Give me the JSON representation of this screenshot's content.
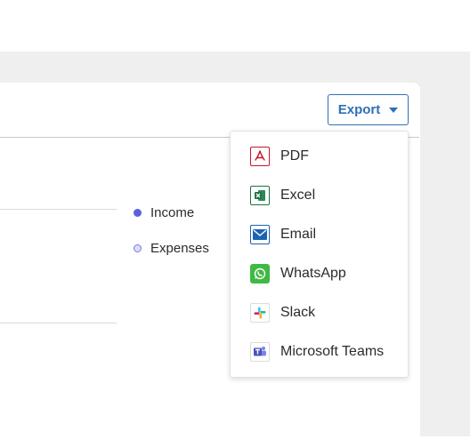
{
  "export": {
    "label": "Export",
    "icon": "chevron-down-icon"
  },
  "legend": [
    {
      "label": "Income",
      "color": "#5b5fe0"
    },
    {
      "label": "Expenses",
      "color": "#d9dbff"
    }
  ],
  "menu": {
    "items": [
      {
        "label": "PDF",
        "icon": "pdf-icon"
      },
      {
        "label": "Excel",
        "icon": "excel-icon"
      },
      {
        "label": "Email",
        "icon": "email-icon"
      },
      {
        "label": "WhatsApp",
        "icon": "whatsapp-icon"
      },
      {
        "label": "Slack",
        "icon": "slack-icon"
      },
      {
        "label": "Microsoft Teams",
        "icon": "microsoft-teams-icon"
      }
    ]
  },
  "colors": {
    "accent": "#2f6fb7",
    "page_background": "#efefef"
  }
}
